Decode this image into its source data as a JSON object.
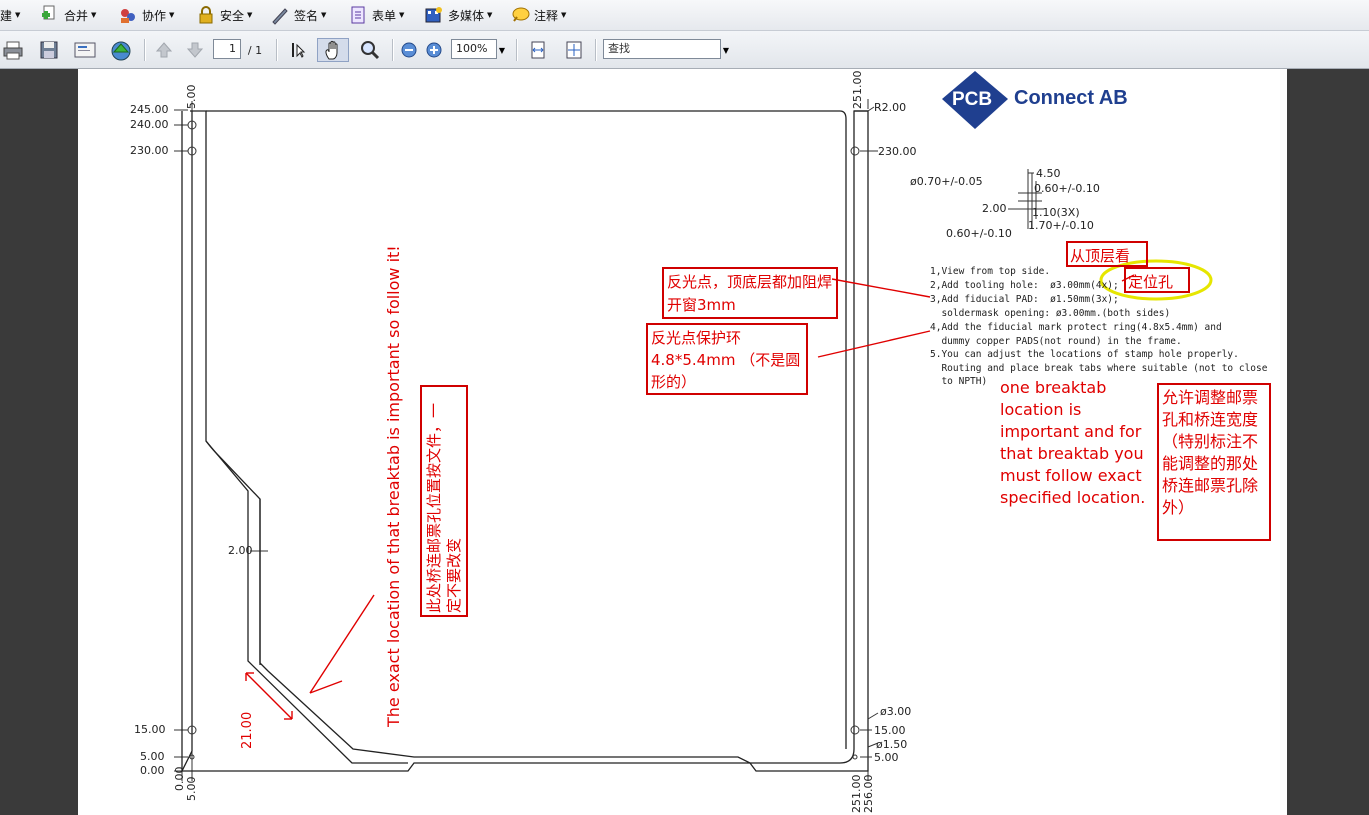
{
  "menubar": {
    "items": [
      {
        "label": "创建",
        "icon": "create-icon"
      },
      {
        "label": "合并",
        "icon": "combine-icon"
      },
      {
        "label": "协作",
        "icon": "collaborate-icon"
      },
      {
        "label": "安全",
        "icon": "lock-icon"
      },
      {
        "label": "签名",
        "icon": "pen-icon"
      },
      {
        "label": "表单",
        "icon": "form-icon"
      },
      {
        "label": "多媒体",
        "icon": "multimedia-icon"
      },
      {
        "label": "注释",
        "icon": "comment-icon"
      }
    ],
    "first_item_visible": "建"
  },
  "toolbar": {
    "page_current": "1",
    "page_total": "/ 1",
    "zoom": "100%",
    "search_placeholder": "查找"
  },
  "logo": {
    "text": "PCB",
    "suffix": "Connect AB",
    "brand_color": "#1f3f8f"
  },
  "drawing": {
    "left_dims": [
      "245.00",
      "240.00",
      "230.00",
      "2.00",
      "15.00",
      "5.00",
      "0.00"
    ],
    "bottom_left": [
      "0.00",
      "5.00"
    ],
    "top_right": "251.00",
    "radius": "R2.00",
    "right_dims": [
      "230.00",
      "ø3.00",
      "15.00",
      "ø1.50",
      "5.00"
    ],
    "bottom_right": [
      "251.00",
      "256.00"
    ],
    "top_left_vertical": "5.00",
    "breaktab_dim": "21.00"
  },
  "detail": {
    "d1": "ø0.70+/-0.05",
    "d2": "4.50",
    "d3": "0.60+/-0.10",
    "d4": "2.00",
    "d5": "1.10(3X)",
    "d6": "1.70+/-0.10",
    "d7": "0.60+/-0.10"
  },
  "notes": {
    "l1": "1,View from top side.",
    "l2": "2,Add tooling hole:  ø3.00mm(4x);",
    "l3": "3,Add fiducial PAD:  ø1.50mm(3x);",
    "l4": "  soldermask opening: ø3.00mm.(both sides)",
    "l5": "4,Add the fiducial mark protect ring(4.8x5.4mm) and",
    "l6": "  dummy copper PADS(not round) in the frame.",
    "l7": "5.You can adjust the locations of stamp hole properly.",
    "l8": "  Routing and place break tabs where suitable (not to close",
    "l9": "  to NPTH)"
  },
  "annotations": {
    "from_top": "从顶层看",
    "tooling_hole": "定位孔",
    "fiducial_open": "反光点，顶底层都加阻焊开窗3mm",
    "fiducial_ring": "反光点保护环4.8*5.4mm （不是圆形的）",
    "breaktab_en": "one breaktab location is important and for that breaktab you must follow exact specified location.",
    "adjust_cn": "允许调整邮票孔和桥连宽度（特别标注不能调整的那处桥连邮票孔除外）",
    "vertical_en": "The exact location of that breaktab is important so follow it!",
    "vertical_cn": "此处桥连邮票孔位置按文件，一定不要改变"
  },
  "colors": {
    "annotation": "#e00000",
    "highlight": "#e6e600"
  }
}
